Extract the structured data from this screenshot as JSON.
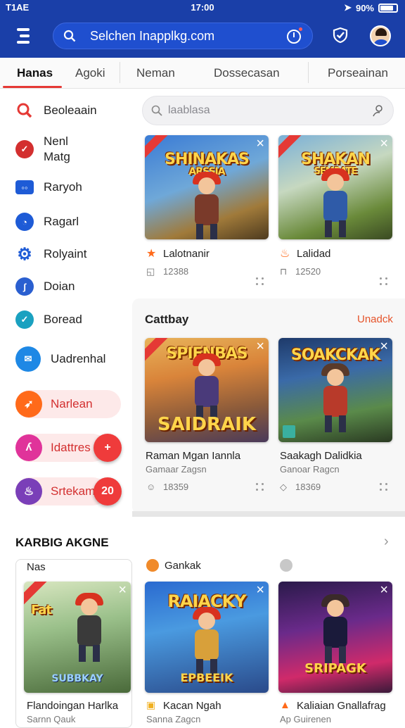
{
  "status": {
    "left": "T1AE",
    "time": "17:00",
    "battery": "90%"
  },
  "url_bar": {
    "text": "Selchen Inapplkg.com"
  },
  "tabs": [
    {
      "label": "Hanas",
      "active": true
    },
    {
      "label": "Agoki"
    },
    {
      "label": "Neman"
    },
    {
      "label": "Dossecasan"
    },
    {
      "label": "Porseainan"
    }
  ],
  "sidebar": {
    "items": [
      {
        "label": "Beoleaain",
        "icon": "search-icon",
        "color": "#e53935"
      },
      {
        "label": "Nenl Matg",
        "icon": "check-badge-icon",
        "color": "#d32f2f"
      },
      {
        "label": "Raryoh",
        "icon": "glasses-icon",
        "color": "#1e5bd6"
      },
      {
        "label": "Ragarl",
        "icon": "circle-badge-icon",
        "color": "#1e5bd6"
      },
      {
        "label": "Rolyaint",
        "icon": "gear-icon",
        "color": "#1e5bd6"
      },
      {
        "label": "Doian",
        "icon": "link-icon",
        "color": "#2a5fd0"
      },
      {
        "label": "Boread",
        "icon": "check-circle-icon",
        "color": "#1aa1c0"
      },
      {
        "label": "Uadrenhal",
        "icon": "mail-icon",
        "color": "#1e88e5"
      }
    ],
    "pills": [
      {
        "label": "Narlean",
        "icon": "rocket-icon",
        "color": "#ff6a1a"
      },
      {
        "label": "Idattres",
        "icon": "curl-icon",
        "color": "#e0339a",
        "fab": "+"
      },
      {
        "label": "Srtekam",
        "icon": "flame-icon",
        "color": "#7a3fb8",
        "fab": "20"
      }
    ]
  },
  "content_search": {
    "placeholder": "laablasa"
  },
  "top_games": [
    {
      "art_title": "SHINAKAS",
      "art_sub": "ARSSIA",
      "name": "Lalotnanir",
      "meta": "12388"
    },
    {
      "art_title": "SHAKAN",
      "art_sub": "SEMBATE",
      "name": "Lalidad",
      "meta": "12520"
    }
  ],
  "section": {
    "title": "Cattbay",
    "action": "Unadck"
  },
  "section_games": [
    {
      "art_title": "SPIFNBAS",
      "art_sub": "SAIDRAIK",
      "name": "Raman Mgan Iannla",
      "sub": "Gamaar Zagsn",
      "meta": "18359"
    },
    {
      "art_title": "SOAKCKAK",
      "art_sub": "",
      "name": "Saakagh Dalidkia",
      "sub": "Ganoar Ragcn",
      "meta": "18369"
    }
  ],
  "bottom": {
    "title": "KARBIG AKGNE",
    "labels": [
      "Nas",
      "Gankak"
    ],
    "games": [
      {
        "art_title": "Fat",
        "art_sub": "SUBBKAY",
        "name": "Flandoingan Harlka",
        "sub": "Sarnn Qauk"
      },
      {
        "art_title": "RAIACKY",
        "art_sub": "EPBEEIK",
        "name": "Kacan Ngah",
        "sub": "Sanna Zagcn"
      },
      {
        "art_title": "SRIPAGK",
        "art_sub": "",
        "name": "Kaliaian Gnallafrag",
        "sub": "Ap Guirenen"
      }
    ]
  },
  "colors": {
    "primary": "#1a3fa8",
    "accent": "#e53935"
  }
}
